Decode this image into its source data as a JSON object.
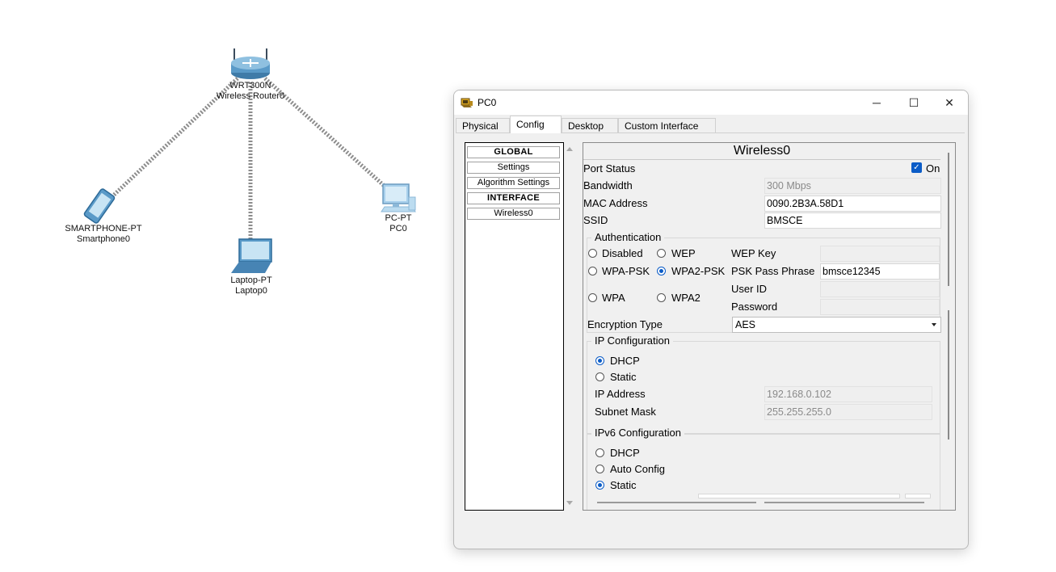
{
  "topology": {
    "router": {
      "model": "WRT300N",
      "name": "Wireless Router0"
    },
    "smartphone": {
      "model": "SMARTPHONE-PT",
      "name": "Smartphone0"
    },
    "laptop": {
      "model": "Laptop-PT",
      "name": "Laptop0"
    },
    "pc": {
      "model": "PC-PT",
      "name": "PC0"
    }
  },
  "window": {
    "title": "PC0",
    "tabs": [
      "Physical",
      "Config",
      "Desktop",
      "Custom Interface"
    ],
    "active_tab": "Config",
    "controls": {
      "minimize": "─",
      "maximize": "☐",
      "close": "✕"
    }
  },
  "nav": {
    "global": "GLOBAL",
    "settings": "Settings",
    "algorithm": "Algorithm Settings",
    "interface": "INTERFACE",
    "wireless0": "Wireless0"
  },
  "wireless": {
    "title": "Wireless0",
    "port_status_label": "Port Status",
    "port_on_label": "On",
    "port_on": true,
    "bandwidth_label": "Bandwidth",
    "bandwidth": "300 Mbps",
    "mac_label": "MAC Address",
    "mac": "0090.2B3A.58D1",
    "ssid_label": "SSID",
    "ssid": "BMSCE",
    "auth": {
      "title": "Authentication",
      "disabled": "Disabled",
      "wep": "WEP",
      "wep_key_label": "WEP Key",
      "wpa_psk": "WPA-PSK",
      "wpa2_psk": "WPA2-PSK",
      "psk_label": "PSK Pass Phrase",
      "psk": "bmsce12345",
      "wpa": "WPA",
      "wpa2": "WPA2",
      "user_id_label": "User ID",
      "password_label": "Password",
      "selected": "WPA2-PSK"
    },
    "encryption_label": "Encryption Type",
    "encryption": "AES",
    "ip": {
      "title": "IP Configuration",
      "dhcp": "DHCP",
      "static": "Static",
      "selected": "DHCP",
      "ip_label": "IP Address",
      "ip": "192.168.0.102",
      "mask_label": "Subnet Mask",
      "mask": "255.255.255.0"
    },
    "ipv6": {
      "title": "IPv6 Configuration",
      "dhcp": "DHCP",
      "auto": "Auto Config",
      "static": "Static",
      "selected": "Static"
    }
  }
}
